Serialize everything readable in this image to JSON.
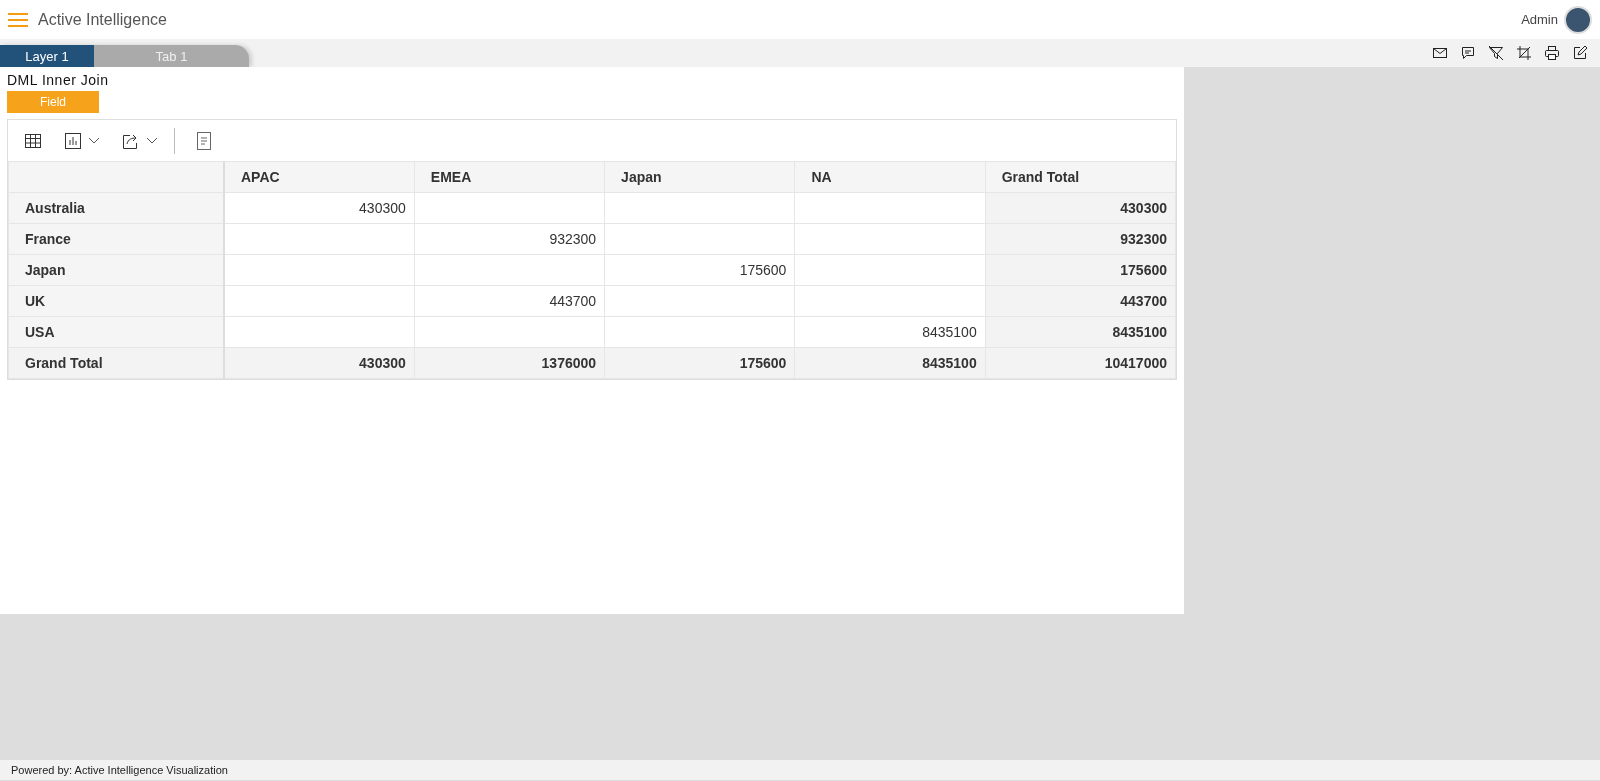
{
  "app": {
    "title": "Active Intelligence",
    "user": "Admin"
  },
  "tabs": [
    {
      "label": "Layer 1",
      "selected": true
    },
    {
      "label": "Tab 1",
      "selected": false
    }
  ],
  "report": {
    "title": "DML Inner Join",
    "field_button": "Field"
  },
  "table": {
    "columns": [
      "APAC",
      "EMEA",
      "Japan",
      "NA",
      "Grand Total"
    ],
    "rows": [
      {
        "label": "Australia",
        "cells": [
          "430300",
          "",
          "",
          "",
          "430300"
        ],
        "total": false
      },
      {
        "label": "France",
        "cells": [
          "",
          "932300",
          "",
          "",
          "932300"
        ],
        "total": false
      },
      {
        "label": "Japan",
        "cells": [
          "",
          "",
          "175600",
          "",
          "175600"
        ],
        "total": false
      },
      {
        "label": "UK",
        "cells": [
          "",
          "443700",
          "",
          "",
          "443700"
        ],
        "total": false
      },
      {
        "label": "USA",
        "cells": [
          "",
          "",
          "",
          "8435100",
          "8435100"
        ],
        "total": false
      },
      {
        "label": "Grand Total",
        "cells": [
          "430300",
          "1376000",
          "175600",
          "8435100",
          "10417000"
        ],
        "total": true
      }
    ]
  },
  "status_bar": "Powered by: Active Intelligence Visualization"
}
